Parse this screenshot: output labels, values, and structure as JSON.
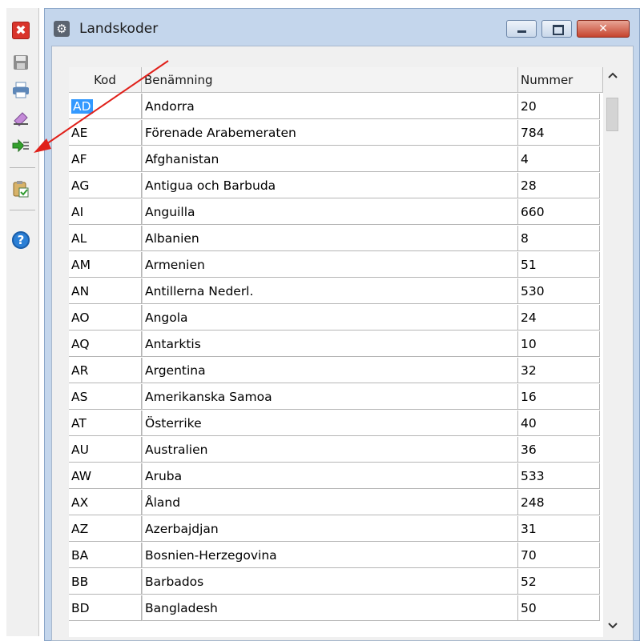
{
  "toolbar": {
    "items": [
      {
        "icon": "close-icon",
        "glyph": "✖"
      },
      {
        "icon": "save-disk-icon",
        "glyph": "💾"
      },
      {
        "icon": "printer-icon",
        "glyph": "🖶"
      },
      {
        "icon": "eraser-icon",
        "glyph": "✎"
      },
      {
        "icon": "import-arrow-icon",
        "glyph": "➔"
      },
      {
        "icon": "clipboard-check-icon",
        "glyph": "📋"
      },
      {
        "icon": "help-icon",
        "glyph": "?"
      }
    ]
  },
  "window": {
    "title": "Landskoder",
    "title_icon": "gear-icon",
    "close_glyph": "✕"
  },
  "grid": {
    "columns": [
      "Kod",
      "Benämning",
      "Nummer"
    ],
    "rows": [
      {
        "kod": "AD",
        "benamning": "Andorra",
        "nummer": "20"
      },
      {
        "kod": "AE",
        "benamning": "Förenade Arabemeraten",
        "nummer": "784"
      },
      {
        "kod": "AF",
        "benamning": "Afghanistan",
        "nummer": "4"
      },
      {
        "kod": "AG",
        "benamning": "Antigua och Barbuda",
        "nummer": "28"
      },
      {
        "kod": "AI",
        "benamning": "Anguilla",
        "nummer": "660"
      },
      {
        "kod": "AL",
        "benamning": "Albanien",
        "nummer": "8"
      },
      {
        "kod": "AM",
        "benamning": "Armenien",
        "nummer": "51"
      },
      {
        "kod": "AN",
        "benamning": "Antillerna Nederl.",
        "nummer": "530"
      },
      {
        "kod": "AO",
        "benamning": "Angola",
        "nummer": "24"
      },
      {
        "kod": "AQ",
        "benamning": "Antarktis",
        "nummer": "10"
      },
      {
        "kod": "AR",
        "benamning": "Argentina",
        "nummer": "32"
      },
      {
        "kod": "AS",
        "benamning": "Amerikanska Samoa",
        "nummer": "16"
      },
      {
        "kod": "AT",
        "benamning": "Österrike",
        "nummer": "40"
      },
      {
        "kod": "AU",
        "benamning": "Australien",
        "nummer": "36"
      },
      {
        "kod": "AW",
        "benamning": "Aruba",
        "nummer": "533"
      },
      {
        "kod": "AX",
        "benamning": "Åland",
        "nummer": "248"
      },
      {
        "kod": "AZ",
        "benamning": "Azerbajdjan",
        "nummer": "31"
      },
      {
        "kod": "BA",
        "benamning": "Bosnien-Herzegovina",
        "nummer": "70"
      },
      {
        "kod": "BB",
        "benamning": "Barbados",
        "nummer": "52"
      },
      {
        "kod": "BD",
        "benamning": "Bangladesh",
        "nummer": "50"
      }
    ],
    "selected_row": 0
  },
  "scrollbar": {
    "up_glyph": "⌃",
    "down_glyph": "⌄"
  },
  "colors": {
    "selection": "#3399ff",
    "annotation_arrow": "#e0201a",
    "window_frame": "#c4d6ec"
  }
}
